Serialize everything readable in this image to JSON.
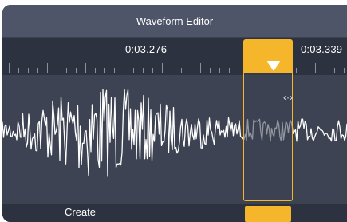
{
  "window": {
    "title": "Waveform Editor"
  },
  "ruler": {
    "time_labels": [
      "0:03.276",
      "0:03.339"
    ]
  },
  "footer": {
    "label": "Create"
  },
  "cursor": {
    "icon": "resize-horizontal-icon",
    "glyph": "‹·›"
  },
  "colors": {
    "accent": "#f6b62b",
    "panel": "#3c4250",
    "titlebar": "#4f5568",
    "ruler": "#2d3240",
    "waveform": "#ffffff"
  }
}
